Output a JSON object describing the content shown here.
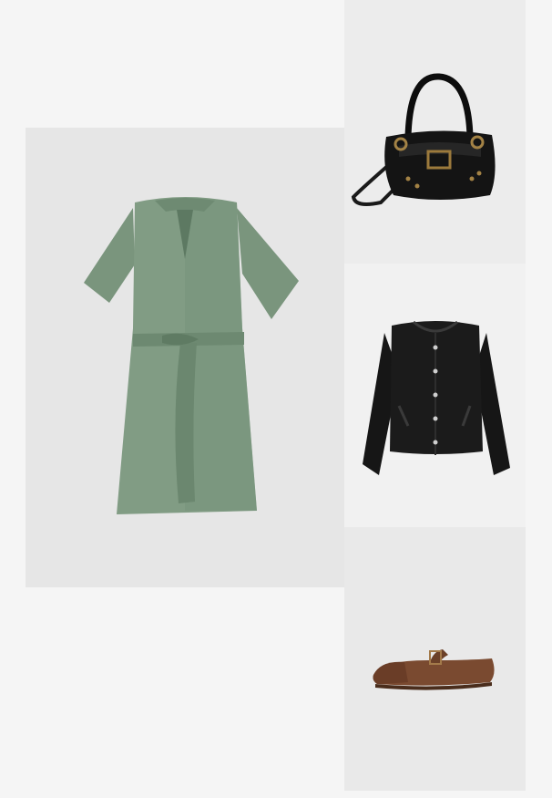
{
  "products": [
    {
      "id": "dress",
      "item": "sage-green-belted-tunic-dress",
      "color": "#7d9880"
    },
    {
      "id": "bag",
      "item": "black-leather-buckle-shoulder-bag",
      "color": "#111111"
    },
    {
      "id": "jacket",
      "item": "black-boucle-collarless-jacket",
      "color": "#151515"
    },
    {
      "id": "shoe",
      "item": "brown-suede-mary-jane-flat",
      "color": "#7a4a30"
    }
  ],
  "colors": {
    "page_background": "#f5f5f5",
    "dress_tile": "#e6e6e6",
    "bag_tile": "#ececec",
    "jacket_tile": "#f1f1f1",
    "shoe_tile": "#e9e9e9"
  }
}
